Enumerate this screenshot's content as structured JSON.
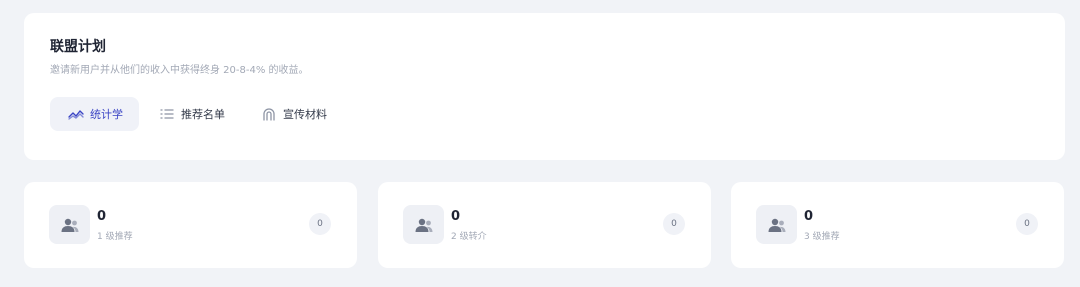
{
  "header": {
    "title": "联盟计划",
    "subtitle": "邀请新用户并从他们的收入中获得终身 20-8-4% 的收益。"
  },
  "tabs": [
    {
      "label": "统计学",
      "icon": "line-chart-icon",
      "active": true
    },
    {
      "label": "推荐名单",
      "icon": "list-icon",
      "active": false
    },
    {
      "label": "宣传材料",
      "icon": "magnet-icon",
      "active": false
    }
  ],
  "stats": [
    {
      "value": "0",
      "label": "1 级推荐",
      "badge": "0",
      "icon": "users-icon"
    },
    {
      "value": "0",
      "label": "2 级转介",
      "badge": "0",
      "icon": "users-icon"
    },
    {
      "value": "0",
      "label": "3 级推荐",
      "badge": "0",
      "icon": "users-icon"
    }
  ],
  "colors": {
    "background": "#f1f3f7",
    "card": "#ffffff",
    "accent": "#3a44c4",
    "muted_text": "#a3a9b6"
  }
}
